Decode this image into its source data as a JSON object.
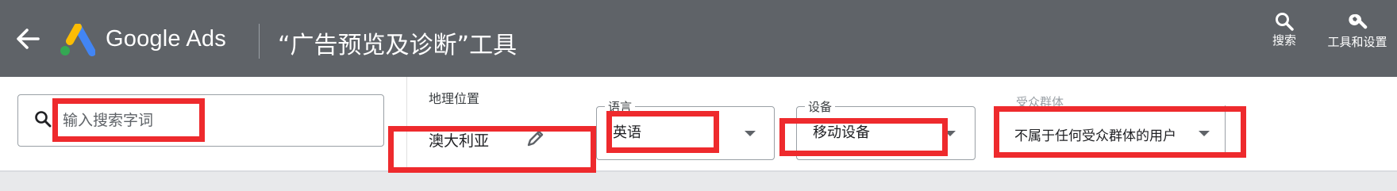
{
  "header": {
    "brand": "Google Ads",
    "page_title": "“广告预览及诊断”工具",
    "search_label": "搜索",
    "tools_label": "工具和设置",
    "bg_color": "#5f6368"
  },
  "icons": [
    "back-arrow-icon",
    "google-ads-logo",
    "search-icon",
    "wrench-icon",
    "pencil-icon",
    "dropdown-caret-icon"
  ],
  "filters": {
    "search_placeholder": "输入搜索字词",
    "geo_label": "地理位置",
    "geo_value": "澳大利亚",
    "language_label": "语言",
    "language_value": "英语",
    "device_label": "设备",
    "device_value": "移动设备",
    "audience_label": "受众群体",
    "audience_value": "不属于任何受众群体的用户"
  },
  "annotations": {
    "highlight_color": "#ee2a2d"
  }
}
